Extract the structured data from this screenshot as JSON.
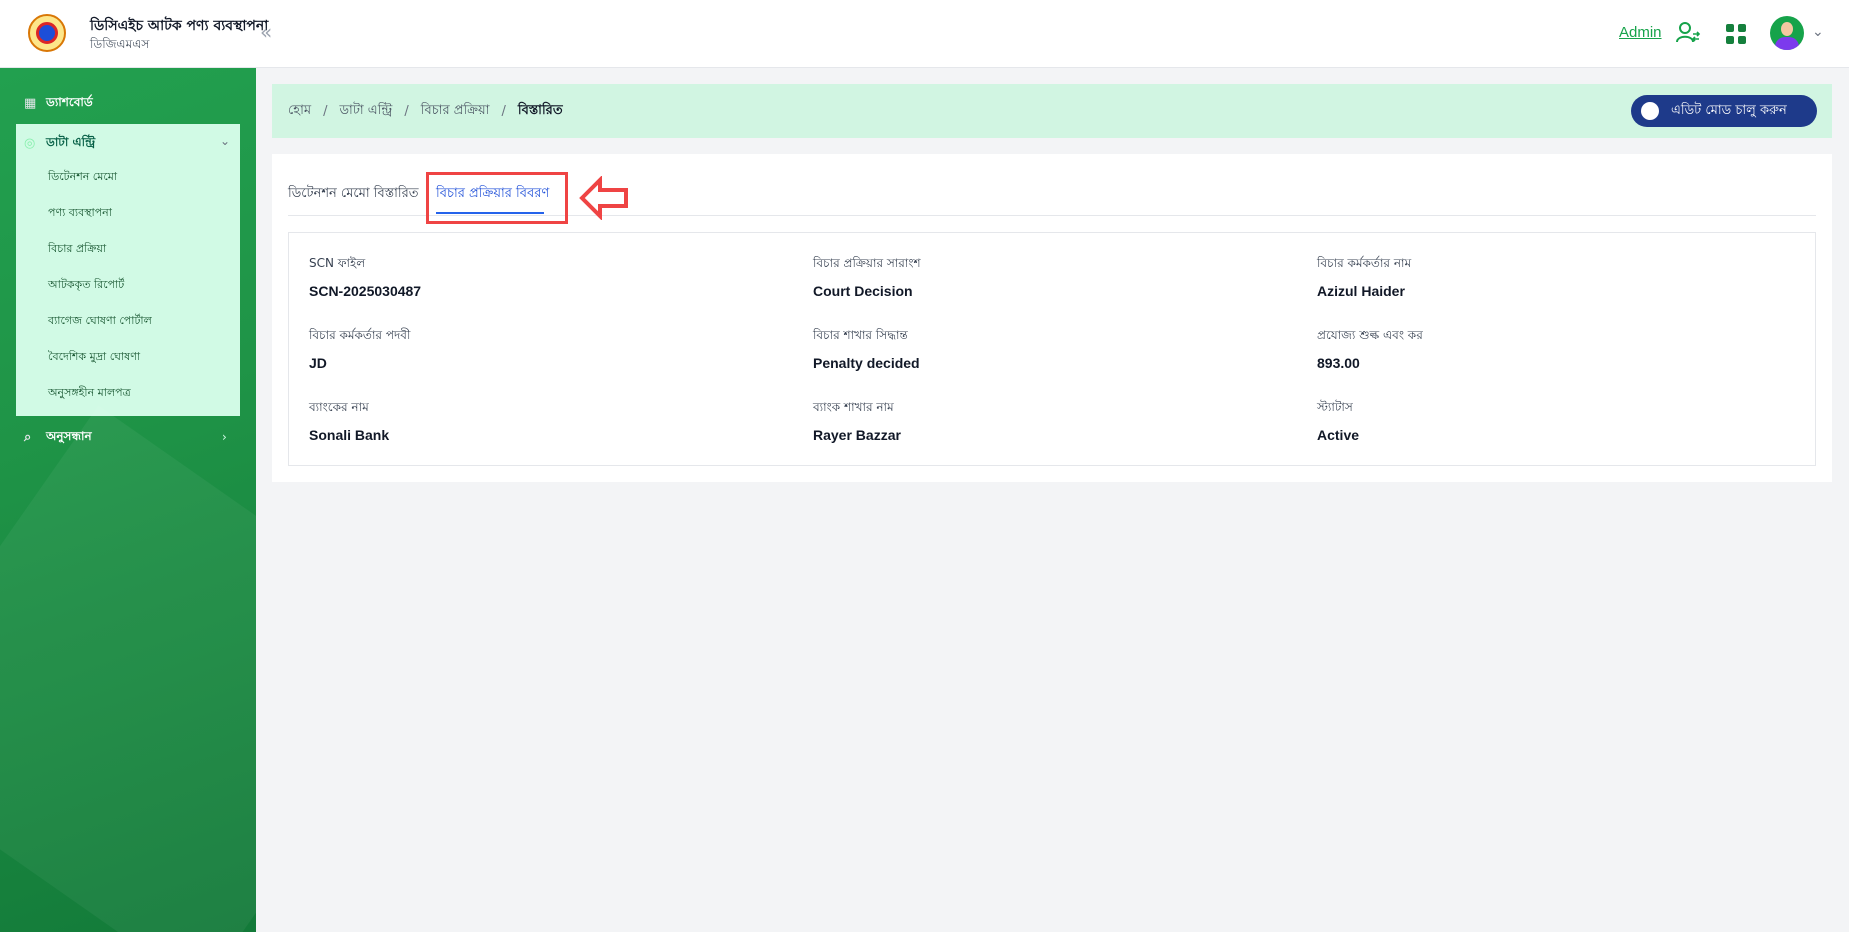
{
  "header": {
    "app_title": "ডিসিএইচ আটক পণ্য ব্যবস্থাপনা",
    "app_subtitle": "ডিজিএমএস",
    "admin_label": "Admin"
  },
  "sidebar": {
    "dashboard": "ড্যাশবোর্ড",
    "data_entry": "ডাটা এন্ট্রি",
    "sub_items": [
      "ডিটেনশন মেমো",
      "পণ্য ব্যবস্থাপনা",
      "বিচার প্রক্রিয়া",
      "আটককৃত রিপোর্ট",
      "ব্যাগেজ ঘোষণা পোর্টাল",
      "বৈদেশিক মুদ্রা ঘোষণা",
      "অনুসঙ্গহীন মালপত্র"
    ],
    "search": "অনুসন্ধান"
  },
  "breadcrumb": {
    "items": [
      "হোম",
      "ডাটা এন্ট্রি",
      "বিচার প্রক্রিয়া"
    ],
    "current": "বিস্তারিত"
  },
  "edit_mode_label": "এডিট মোড চালু করুন",
  "tabs": {
    "tab1": "ডিটেনশন মেমো বিস্তারিত",
    "tab2": "বিচার প্রক্রিয়ার বিবরণ"
  },
  "details": [
    {
      "label": "SCN ফাইল",
      "value": "SCN-2025030487"
    },
    {
      "label": "বিচার প্রক্রিয়ার সারাংশ",
      "value": "Court Decision"
    },
    {
      "label": "বিচার কর্মকর্তার নাম",
      "value": "Azizul Haider"
    },
    {
      "label": "বিচার কর্মকর্তার পদবী",
      "value": "JD"
    },
    {
      "label": "বিচার শাখার সিদ্ধান্ত",
      "value": "Penalty decided"
    },
    {
      "label": "প্রযোজ্য শুল্ক এবং কর",
      "value": "893.00"
    },
    {
      "label": "ব্যাংকের নাম",
      "value": "Sonali Bank"
    },
    {
      "label": "ব্যাংক শাখার নাম",
      "value": "Rayer Bazzar"
    },
    {
      "label": "স্ট্যাটাস",
      "value": "Active"
    }
  ],
  "colors": {
    "brand_green": "#16a34a",
    "active_tab": "#1d4ed8",
    "toggle_bg": "#1e3a8a",
    "annotation_red": "#ef4444"
  }
}
